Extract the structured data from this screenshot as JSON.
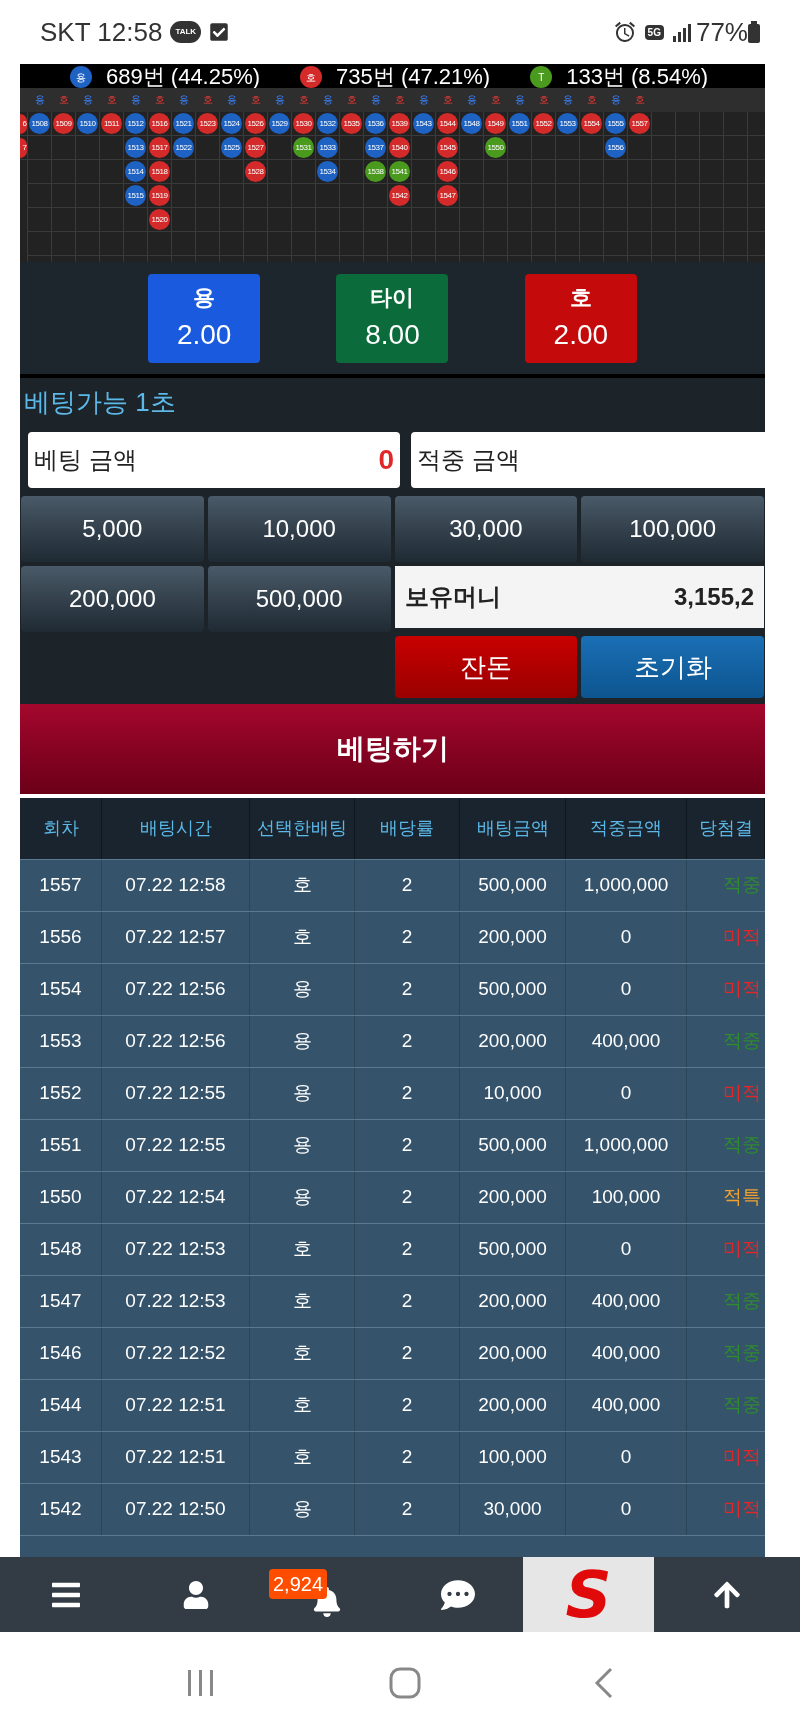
{
  "status_bar": {
    "carrier_time": "SKT 12:58",
    "talk": "TALK",
    "network": "5G",
    "battery": "77%"
  },
  "stats": [
    {
      "badge": "용",
      "color": "#1e63c4",
      "text": "689번 (44.25%)"
    },
    {
      "badge": "호",
      "color": "#d42a2a",
      "text": "735번 (47.21%)"
    },
    {
      "badge": "T",
      "color": "#4a9a1e",
      "text": "133번 (8.54%)"
    }
  ],
  "road_header": [
    {
      "label": "용",
      "kind": "dragon"
    },
    {
      "label": "호",
      "kind": "tiger"
    },
    {
      "label": "용",
      "kind": "dragon"
    },
    {
      "label": "호",
      "kind": "tiger"
    },
    {
      "label": "용",
      "kind": "dragon"
    },
    {
      "label": "호",
      "kind": "tiger"
    },
    {
      "label": "용",
      "kind": "dragon"
    },
    {
      "label": "호",
      "kind": "tiger"
    },
    {
      "label": "용",
      "kind": "dragon"
    },
    {
      "label": "호",
      "kind": "tiger"
    },
    {
      "label": "용",
      "kind": "dragon"
    },
    {
      "label": "호",
      "kind": "tiger"
    },
    {
      "label": "용",
      "kind": "dragon"
    },
    {
      "label": "호",
      "kind": "tiger"
    },
    {
      "label": "용",
      "kind": "dragon"
    },
    {
      "label": "호",
      "kind": "tiger"
    },
    {
      "label": "용",
      "kind": "dragon"
    },
    {
      "label": "호",
      "kind": "tiger"
    },
    {
      "label": "용",
      "kind": "dragon"
    },
    {
      "label": "호",
      "kind": "tiger"
    },
    {
      "label": "용",
      "kind": "dragon"
    },
    {
      "label": "호",
      "kind": "tiger"
    },
    {
      "label": "용",
      "kind": "dragon"
    },
    {
      "label": "호",
      "kind": "tiger"
    },
    {
      "label": "용",
      "kind": "dragon"
    },
    {
      "label": "호",
      "kind": "tiger"
    }
  ],
  "road_partial": [
    {
      "text": "6",
      "color": "#d42a2a"
    },
    {
      "text": "7",
      "color": "#d42a2a"
    }
  ],
  "road": [
    [
      {
        "text": "1508",
        "color": "#1e63c4"
      }
    ],
    [
      {
        "text": "1509",
        "color": "#d42a2a"
      }
    ],
    [
      {
        "text": "1510",
        "color": "#1e63c4"
      }
    ],
    [
      {
        "text": "1511",
        "color": "#d42a2a"
      }
    ],
    [
      {
        "text": "1512",
        "color": "#1e63c4"
      },
      {
        "text": "1513",
        "color": "#1e63c4"
      },
      {
        "text": "1514",
        "color": "#1e63c4"
      },
      {
        "text": "1515",
        "color": "#1e63c4"
      }
    ],
    [
      {
        "text": "1516",
        "color": "#d42a2a"
      },
      {
        "text": "1517",
        "color": "#d42a2a"
      },
      {
        "text": "1518",
        "color": "#d42a2a"
      },
      {
        "text": "1519",
        "color": "#d42a2a"
      },
      {
        "text": "1520",
        "color": "#d42a2a"
      }
    ],
    [
      {
        "text": "1521",
        "color": "#1e63c4"
      },
      {
        "text": "1522",
        "color": "#1e63c4"
      }
    ],
    [
      {
        "text": "1523",
        "color": "#d42a2a"
      }
    ],
    [
      {
        "text": "1524",
        "color": "#1e63c4"
      },
      {
        "text": "1525",
        "color": "#1e63c4"
      }
    ],
    [
      {
        "text": "1526",
        "color": "#d42a2a"
      },
      {
        "text": "1527",
        "color": "#d42a2a"
      },
      {
        "text": "1528",
        "color": "#d42a2a"
      }
    ],
    [
      {
        "text": "1529",
        "color": "#1e63c4"
      }
    ],
    [
      {
        "text": "1530",
        "color": "#d42a2a"
      },
      {
        "text": "1531",
        "color": "#4a9a1e"
      }
    ],
    [
      {
        "text": "1532",
        "color": "#1e63c4"
      },
      {
        "text": "1533",
        "color": "#1e63c4"
      },
      {
        "text": "1534",
        "color": "#1e63c4"
      }
    ],
    [
      {
        "text": "1535",
        "color": "#d42a2a"
      }
    ],
    [
      {
        "text": "1536",
        "color": "#1e63c4"
      },
      {
        "text": "1537",
        "color": "#1e63c4"
      },
      {
        "text": "1538",
        "color": "#4a9a1e"
      }
    ],
    [
      {
        "text": "1539",
        "color": "#d42a2a"
      },
      {
        "text": "1540",
        "color": "#d42a2a"
      },
      {
        "text": "1541",
        "color": "#4a9a1e"
      },
      {
        "text": "1542",
        "color": "#d42a2a"
      }
    ],
    [
      {
        "text": "1543",
        "color": "#1e63c4"
      }
    ],
    [
      {
        "text": "1544",
        "color": "#d42a2a"
      },
      {
        "text": "1545",
        "color": "#d42a2a"
      },
      {
        "text": "1546",
        "color": "#d42a2a"
      },
      {
        "text": "1547",
        "color": "#d42a2a"
      }
    ],
    [
      {
        "text": "1548",
        "color": "#1e63c4"
      }
    ],
    [
      {
        "text": "1549",
        "color": "#d42a2a"
      },
      {
        "text": "1550",
        "color": "#4a9a1e"
      }
    ],
    [
      {
        "text": "1551",
        "color": "#1e63c4"
      }
    ],
    [
      {
        "text": "1552",
        "color": "#d42a2a"
      }
    ],
    [
      {
        "text": "1553",
        "color": "#1e63c4"
      }
    ],
    [
      {
        "text": "1554",
        "color": "#d42a2a"
      }
    ],
    [
      {
        "text": "1555",
        "color": "#1e63c4"
      },
      {
        "text": "1556",
        "color": "#1e63c4"
      }
    ],
    [
      {
        "text": "1557",
        "color": "#d42a2a"
      }
    ]
  ],
  "odds": [
    {
      "kind": "dragon",
      "label": "용",
      "value": "2.00"
    },
    {
      "kind": "tie",
      "label": "타이",
      "value": "8.00"
    },
    {
      "kind": "tiger",
      "label": "호",
      "value": "2.00"
    }
  ],
  "countdown": "베팅가능 1초",
  "fields": [
    {
      "label": "베팅 금액",
      "value": "0"
    },
    {
      "label": "적중 금액"
    }
  ],
  "chips": [
    "5,000",
    "10,000",
    "30,000",
    "100,000",
    "200,000",
    "500,000"
  ],
  "balance": {
    "label": "보유머니",
    "value": "3,155,2"
  },
  "actions": [
    {
      "kind": "change",
      "label": "잔돈"
    },
    {
      "kind": "reset",
      "label": "초기화"
    }
  ],
  "submit": "베팅하기",
  "table": {
    "columns": [
      "회차",
      "배팅시간",
      "선택한배팅",
      "배당률",
      "배팅금액",
      "적중금액",
      "당첨결"
    ],
    "rows": [
      {
        "round": "1557",
        "time": "07.22 12:58",
        "pick": "호",
        "odds": "2",
        "bet": "500,000",
        "payout": "1,000,000",
        "result": "적중",
        "kind": "win"
      },
      {
        "round": "1556",
        "time": "07.22 12:57",
        "pick": "호",
        "odds": "2",
        "bet": "200,000",
        "payout": "0",
        "result": "미적",
        "kind": "lose"
      },
      {
        "round": "1554",
        "time": "07.22 12:56",
        "pick": "용",
        "odds": "2",
        "bet": "500,000",
        "payout": "0",
        "result": "미적",
        "kind": "lose"
      },
      {
        "round": "1553",
        "time": "07.22 12:56",
        "pick": "용",
        "odds": "2",
        "bet": "200,000",
        "payout": "400,000",
        "result": "적중",
        "kind": "win"
      },
      {
        "round": "1552",
        "time": "07.22 12:55",
        "pick": "용",
        "odds": "2",
        "bet": "10,000",
        "payout": "0",
        "result": "미적",
        "kind": "lose"
      },
      {
        "round": "1551",
        "time": "07.22 12:55",
        "pick": "용",
        "odds": "2",
        "bet": "500,000",
        "payout": "1,000,000",
        "result": "적중",
        "kind": "win"
      },
      {
        "round": "1550",
        "time": "07.22 12:54",
        "pick": "용",
        "odds": "2",
        "bet": "200,000",
        "payout": "100,000",
        "result": "적특",
        "kind": "special"
      },
      {
        "round": "1548",
        "time": "07.22 12:53",
        "pick": "호",
        "odds": "2",
        "bet": "500,000",
        "payout": "0",
        "result": "미적",
        "kind": "lose"
      },
      {
        "round": "1547",
        "time": "07.22 12:53",
        "pick": "호",
        "odds": "2",
        "bet": "200,000",
        "payout": "400,000",
        "result": "적중",
        "kind": "win"
      },
      {
        "round": "1546",
        "time": "07.22 12:52",
        "pick": "호",
        "odds": "2",
        "bet": "200,000",
        "payout": "400,000",
        "result": "적중",
        "kind": "win"
      },
      {
        "round": "1544",
        "time": "07.22 12:51",
        "pick": "호",
        "odds": "2",
        "bet": "200,000",
        "payout": "400,000",
        "result": "적중",
        "kind": "win"
      },
      {
        "round": "1543",
        "time": "07.22 12:51",
        "pick": "호",
        "odds": "2",
        "bet": "100,000",
        "payout": "0",
        "result": "미적",
        "kind": "lose"
      },
      {
        "round": "1542",
        "time": "07.22 12:50",
        "pick": "용",
        "odds": "2",
        "bet": "30,000",
        "payout": "0",
        "result": "미적",
        "kind": "lose"
      }
    ]
  },
  "bottom_nav": {
    "badge": "2,924",
    "logo": "S"
  }
}
